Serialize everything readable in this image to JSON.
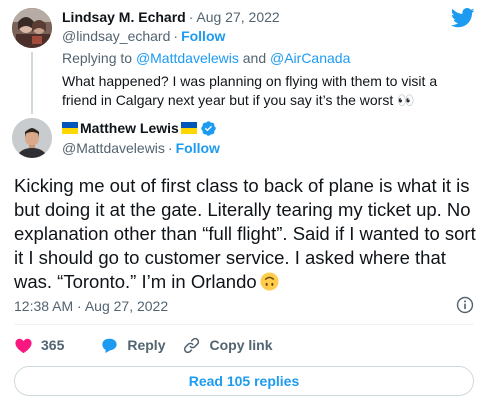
{
  "reply": {
    "name": "Lindsay M. Echard",
    "dot": "·",
    "date": "Aug 27, 2022",
    "handle": "@lindsay_echard",
    "follow": "Follow",
    "replying_prefix": "Replying to ",
    "mention1": "@Mattdavelewis",
    "and_word": " and ",
    "mention2": "@AirCanada",
    "text": "What happened? I was planning on flying with them to visit a friend in Calgary next year but if you say it’s the worst 👀"
  },
  "main": {
    "name": "Matthew Lewis",
    "handle": "@Mattdavelewis",
    "follow": "Follow",
    "text": "Kicking me out of first class to back of plane is what it is but doing it at the gate. Literally tearing my ticket up. No explanation other than “full flight”. Said if I wanted to sort it I should go to customer service. I asked where that was. “Toronto.” I’m in Orlando",
    "timestamp": "12:38 AM · Aug 27, 2022"
  },
  "actions": {
    "like_count": "365",
    "reply_label": "Reply",
    "copy_label": "Copy link"
  },
  "read_replies": "Read 105 replies",
  "colors": {
    "accent": "#1d9bf0",
    "like": "#f91880",
    "muted": "#536471"
  },
  "icons": [
    "twitter-bird-icon",
    "verified-badge-icon",
    "info-icon",
    "heart-icon",
    "reply-bubble-icon",
    "link-icon",
    "upside-down-face-emoji",
    "eyes-emoji"
  ]
}
